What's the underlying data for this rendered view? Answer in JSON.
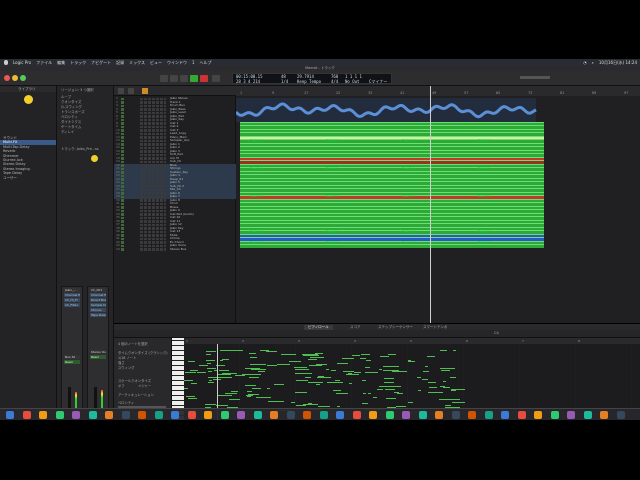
{
  "menubar": {
    "app": "Logic Pro",
    "items": [
      "ファイル",
      "編集",
      "トラック",
      "ナビゲート",
      "記録",
      "ミックス",
      "ビュー",
      "ウインドウ",
      "1",
      "ヘルプ"
    ],
    "clock": "10月16日(水) 14:24"
  },
  "window_title": "Maerot - トラック",
  "lcd": {
    "time": "00:15:00.15",
    "bars": "28 3 4 214",
    "beat_frac": "1/4",
    "position": "48",
    "tempo_value": "29.7914",
    "tempo_label": "Keep Tempo",
    "signature": "4/4",
    "key": "Cマイナー",
    "midi_in": "No In",
    "midi_out": "No Out",
    "marker": "768",
    "marker2": "1 1 1 1"
  },
  "library": {
    "title": "ライブラリ",
    "items": [
      "サウンド",
      "Multi-FX",
      "Multi-Tap Delay",
      "Reverb",
      "Shimmer",
      "Slurred Ack",
      "Stereo Delay",
      "Stereo Imaging",
      "Tape Delay",
      "ユーザー"
    ]
  },
  "inspector": {
    "region_header": "リージョン: 3 つ選択",
    "track_header": "トラック: Jaiko_Pre...ss",
    "rows": [
      "ループ",
      "クオンタイズ",
      "Q-スウィング",
      "トランスポーズ",
      "ベロシティ",
      "ダイナミクス",
      "ゲートタイム",
      "ディレイ"
    ],
    "strip1_name": "Jaiko_...",
    "strip2_name": "Ch_001",
    "slots1": [
      "Channel EQ",
      "Ch_Hi_Fi",
      "Ch_Filter"
    ],
    "slots2": [
      "Channel EQ",
      "Direct Box",
      "Sample Del.",
      "Chorus",
      "Tape Delay"
    ],
    "bus": "Bus 30",
    "out": "Stereo Out",
    "read1": "Read",
    "read2": "Read",
    "bottom_left": "Jaiko_Pre...",
    "bottom_right": "Stereo Out"
  },
  "tracklist": {
    "names": [
      "Jaiko Stereo",
      "Track 1",
      "Drum Bus",
      "Jaiko_Bass",
      "Jaiko_Lead",
      "Jaiko_Pad",
      "Jaiko_Key",
      "Inst 1",
      "Inst 2",
      "Inst 3",
      "Lead_Copy",
      "Piano_Main",
      "Sampler_Grp",
      "Jaiko 1",
      "Jaiko 2",
      "Jaiko 3",
      "Soft_Pad",
      "Arp Hi",
      "Sub_Ch",
      "Blue",
      "Strings",
      "Sustain_Key",
      "Jaiko 4",
      "Deep_01",
      "Jaiko 5",
      "Sub_Ch 2",
      "Mix_Ch",
      "Jaiko 6",
      "Jaiko 7",
      "Jaiko 8",
      "Choir",
      "Brass",
      "Jaiko 9",
      "Inst Pad (Audio)",
      "Inst 10",
      "Inst 11",
      "Jaiko 12",
      "Jaiko Key",
      "Inst 13",
      "Mute",
      "Chime",
      "Ev Chord",
      "Jaiko Voice",
      "Stereo Bus"
    ]
  },
  "ruler_marks": [
    "1",
    "9",
    "17",
    "25",
    "33",
    "41",
    "49",
    "57",
    "65",
    "73",
    "81",
    "89",
    "97"
  ],
  "region_label": "Maerot_3",
  "editor": {
    "tabs": [
      "ピアノロール",
      "スコア",
      "ステップシーケンサー",
      "スマートテンポ"
    ],
    "inspector_rows": [
      "4 個のノートを選択",
      "タイムクオンタイズ (クラシック)",
      "1/16 ノート",
      "強さ",
      "スウィング",
      "スケールクオンタイズ",
      "オフ",
      "メジャー",
      "ベロシティ",
      "アーティキュレーション"
    ],
    "roll_marks": [
      "1",
      "2",
      "3",
      "4",
      "5",
      "6",
      "7",
      "8"
    ],
    "key_display": "C4"
  },
  "colors": {
    "accent": "#3a5b8a",
    "region_green": "#2fa83a",
    "region_blue": "#2a58c8",
    "region_red": "#c0392b",
    "note_green": "#4fbf52"
  },
  "dock_icon_count": 38
}
